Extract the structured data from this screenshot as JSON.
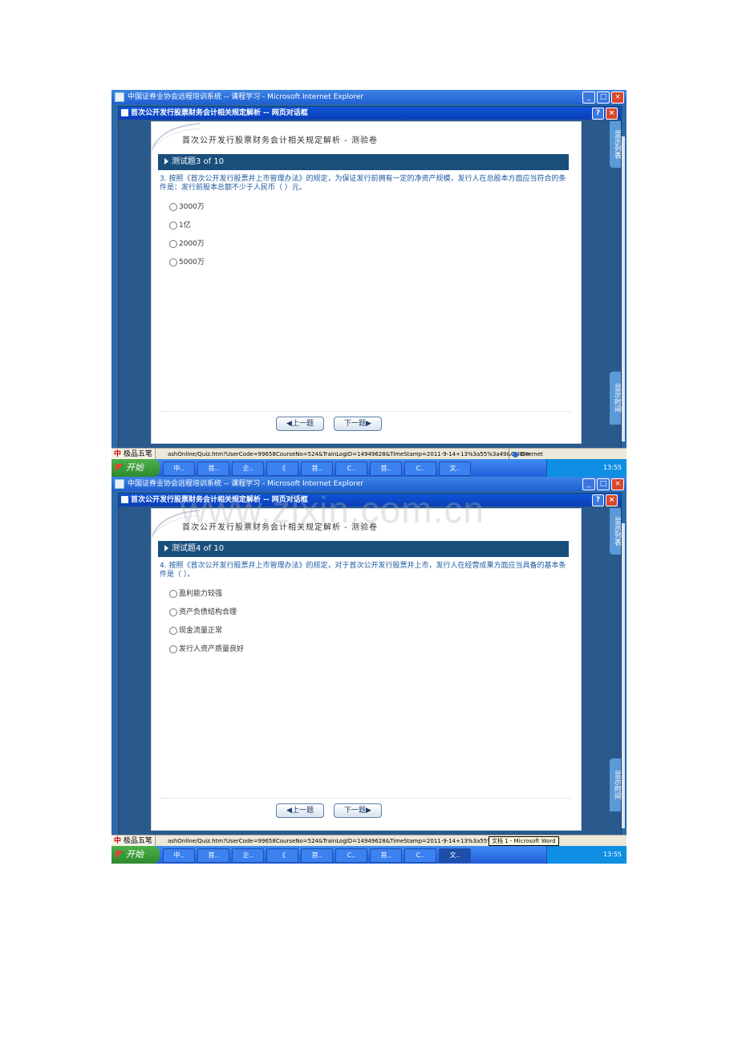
{
  "browser": {
    "title": "中国证券业协会远程培训系统 -- 课程学习 - Microsoft Internet Explorer",
    "zone": "Internet"
  },
  "dialog": {
    "title": "首次公开发行股票财务会计相关规定解析 -- 网页对话框",
    "quiz_title": "首次公开发行股票财务会计相关规定解析 - 测验卷",
    "side_tab_top": "显示列表",
    "side_tab_bottom": "显示时间",
    "prev_label": "◀上一题",
    "next_label": "下一题▶"
  },
  "statusbar": {
    "ime_label": "极品五笔",
    "url": "ashOnline/Quiz.htm?UserCode=99658CourseNo=524&TrainLogID=14949628&TimeStamp=2011-9-14+13%3a55%3a49&GUID="
  },
  "taskbar": {
    "start_label": "开始",
    "items": [
      "中..",
      "首..",
      "企..",
      "《",
      "首..",
      "C..",
      "首..",
      "C..",
      "文.."
    ],
    "clock": "13:55"
  },
  "screens": [
    {
      "question_header": "测试题3 of 10",
      "question_text": "3. 按照《首次公开发行股票并上市管理办法》的规定，为保证发行前拥有一定的净资产规模，发行人在总股本方面应当符合的条件是：发行前股本总额不少于人民币（    ）元。",
      "options": [
        "3000万",
        "1亿",
        "2000万",
        "5000万"
      ]
    },
    {
      "question_header": "测试题4 of 10",
      "question_text": "4. 按照《首次公开发行股票并上市管理办法》的规定，对于首次公开发行股票并上市，发行人在经营成果方面应当具备的基本条件是（    ）。",
      "options": [
        "盈利能力较强",
        "资产负债结构合理",
        "现金流量正常",
        "发行人资产质量良好"
      ],
      "tooltip": "文档 1 - Microsoft Word"
    }
  ],
  "watermark": "www.zixin.com.cn"
}
